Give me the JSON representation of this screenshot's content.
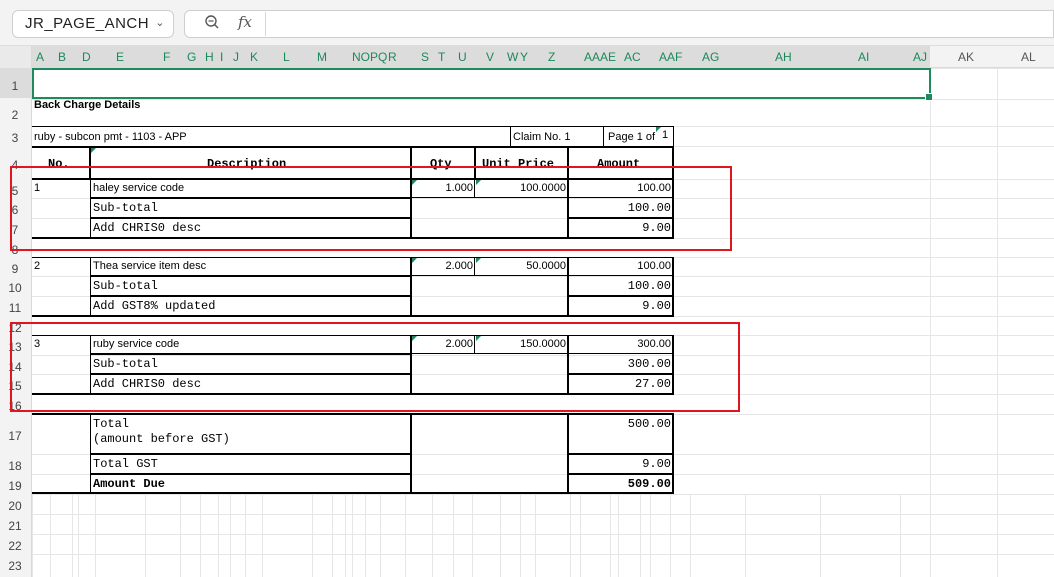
{
  "formula_bar": {
    "name_box": "JR_PAGE_ANCH",
    "formula": ""
  },
  "columns": [
    "A",
    "B",
    "D",
    "E",
    "F",
    "G",
    "H",
    "I",
    "J",
    "K",
    "L",
    "M",
    "NOPQ",
    "R",
    "S",
    "T",
    "U",
    "V",
    "W",
    "Y",
    "Z",
    "AAAE",
    "AC",
    "AAF",
    "AG",
    "AH",
    "AI",
    "AJ",
    "AK",
    "AL"
  ],
  "rows": [
    "1",
    "2",
    "3",
    "4",
    "5",
    "6",
    "7",
    "8",
    "9",
    "10",
    "11",
    "12",
    "13",
    "14",
    "15",
    "16",
    "17",
    "18",
    "19",
    "20",
    "21",
    "22",
    "23"
  ],
  "sheet": {
    "title": "Back Charge Details",
    "header_info": "ruby - subcon pmt - 1103 - APP",
    "claim_no": "Claim No. 1",
    "page_of": "Page 1 of",
    "page_total": "1",
    "table_headers": {
      "no": "No.",
      "description": "Description",
      "qty": "Qty",
      "unit_price": "Unit Price",
      "amount": "Amount"
    },
    "items": [
      {
        "no": "1",
        "description": "haley service code",
        "qty": "1.000",
        "unit_price": "100.0000",
        "amount": "100.00",
        "subtotal_label": "Sub-total",
        "subtotal": "100.00",
        "tax_label": "Add CHRIS0 desc",
        "tax": "9.00"
      },
      {
        "no": "2",
        "description": "Thea service item desc",
        "qty": "2.000",
        "unit_price": "50.0000",
        "amount": "100.00",
        "subtotal_label": "Sub-total",
        "subtotal": "100.00",
        "tax_label": "Add GST8% updated",
        "tax": "9.00"
      },
      {
        "no": "3",
        "description": "ruby service code",
        "qty": "2.000",
        "unit_price": "150.0000",
        "amount": "300.00",
        "subtotal_label": "Sub-total",
        "subtotal": "300.00",
        "tax_label": "Add CHRIS0 desc",
        "tax": "27.00"
      }
    ],
    "totals": {
      "total_label_1": "Total",
      "total_label_2": "(amount before GST)",
      "total": "500.00",
      "gst_label": "Total GST",
      "gst": "9.00",
      "due_label": "Amount Due",
      "due": "509.00"
    }
  },
  "colors": {
    "accent": "#1f8a5b",
    "annotation": "#e0161e"
  }
}
